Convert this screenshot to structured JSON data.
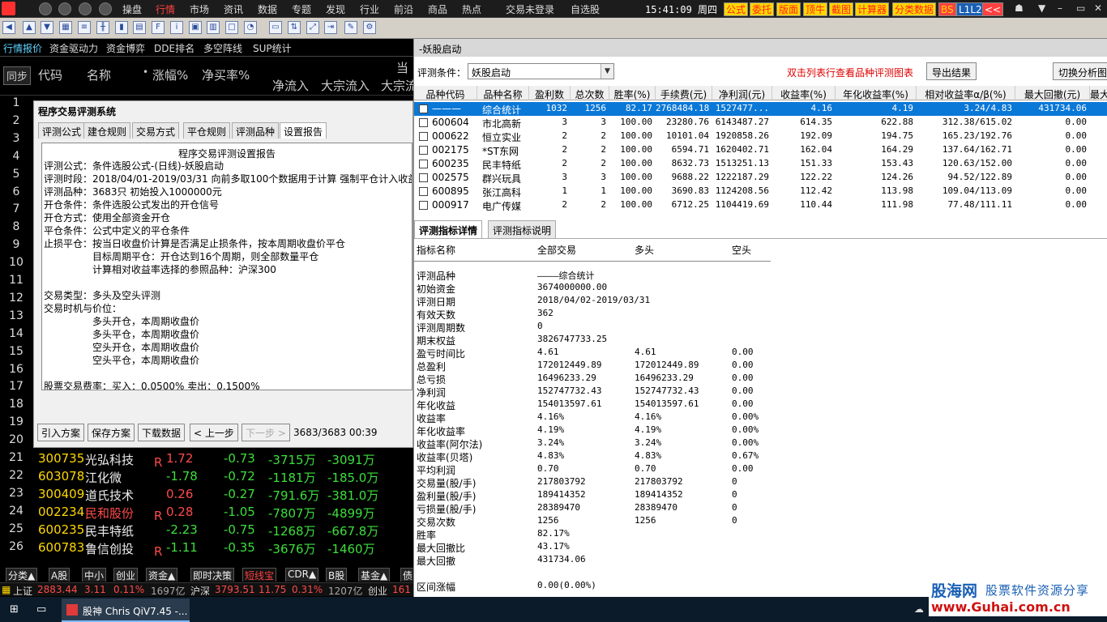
{
  "menubar": {
    "items": [
      "操盘",
      "行情",
      "市场",
      "资讯",
      "数据",
      "专题",
      "发现",
      "行业",
      "前沿",
      "商品",
      "热点"
    ],
    "active_index": 1,
    "login": "交易未登录",
    "watchlist": "自选股",
    "clock": "15:41:09 周四",
    "right_buttons": [
      "公式",
      "委托",
      "版面",
      "顶牛",
      "截图",
      "计算器",
      "分类数据",
      "BS",
      "L1L2",
      "<<"
    ]
  },
  "left_tabs": [
    "行情报价",
    "资金驱动力",
    "资金博弈",
    "DDE排名",
    "多空阵线",
    "SUP统计"
  ],
  "quote_header": {
    "sync": "同步",
    "code": "代码",
    "name": "名称",
    "dot": "•",
    "change_pct": "涨幅%",
    "net_buy_rate": "净买率%",
    "current": "当",
    "net_inflow": "净流入",
    "big_inflow": "大宗流入",
    "big_out": "大宗流"
  },
  "row_numbers": [
    "1",
    "2",
    "3",
    "4",
    "5",
    "6",
    "7",
    "8",
    "9",
    "10",
    "11",
    "12",
    "13",
    "14",
    "15",
    "16",
    "17",
    "18",
    "19",
    "20"
  ],
  "quote_rows": [
    {
      "num": "21",
      "code": "300735",
      "name": "光弘科技",
      "badge": "R",
      "chg": "1.72",
      "chg_color": "r",
      "rate": "-0.73",
      "inflow": "-3715万",
      "big": "-3091万",
      "name_color": ""
    },
    {
      "num": "22",
      "code": "603078",
      "name": "江化微",
      "badge": "",
      "chg": "-1.78",
      "chg_color": "g",
      "rate": "-0.72",
      "inflow": "-1181万",
      "big": "-185.0万",
      "name_color": ""
    },
    {
      "num": "23",
      "code": "300409",
      "name": "道氏技术",
      "badge": "",
      "chg": "0.26",
      "chg_color": "r",
      "rate": "-0.27",
      "inflow": "-791.6万",
      "big": "-381.0万",
      "name_color": ""
    },
    {
      "num": "24",
      "code": "002234",
      "name": "民和股份",
      "badge": "R",
      "chg": "0.28",
      "chg_color": "r",
      "rate": "-1.05",
      "inflow": "-7807万",
      "big": "-4899万",
      "name_color": "red"
    },
    {
      "num": "25",
      "code": "600235",
      "name": "民丰特纸",
      "badge": "",
      "chg": "-2.23",
      "chg_color": "g",
      "rate": "-0.75",
      "inflow": "-1268万",
      "big": "-667.8万",
      "name_color": ""
    },
    {
      "num": "26",
      "code": "600783",
      "name": "鲁信创投",
      "badge": "R",
      "chg": "-1.11",
      "chg_color": "g",
      "rate": "-0.35",
      "inflow": "-3676万",
      "big": "-1460万",
      "name_color": ""
    }
  ],
  "bottom_tabs": [
    "分类▲",
    "A股",
    "中小",
    "创业",
    "资金▲",
    "即时决策",
    "短线宝",
    "CDR▲",
    "B股",
    "基金▲",
    "债"
  ],
  "bottom_active": 6,
  "status": {
    "sh_label": "上证",
    "sh_value": "2883.44",
    "sh_chg": "3.11",
    "sh_pct": "0.11%",
    "sh_vol": "1697亿",
    "sz_label": "沪深",
    "sz_value": "3793.51",
    "sz_chg": "11.75",
    "sz_pct": "0.31%",
    "sz_vol": "1207亿",
    "cy_label": "创业",
    "cy_value": "161"
  },
  "taskbar": {
    "app": "股神 Chris QiV7.45 -..."
  },
  "dialog": {
    "title": "程序交易评测系统",
    "tabs": [
      "评测公式",
      "建仓规则",
      "交易方式",
      "平仓规则",
      "评测品种",
      "设置报告"
    ],
    "active_tab": 5,
    "report_title": "程序交易评测设置报告",
    "lines": [
      "评测公式：条件选股公式-(日线)-妖股启动",
      "评测时段：2018/04/01-2019/03/31 向前多取100个数据用于计算 强制平仓计入收益",
      "评测品种：3683只 初始投入1000000元",
      "开仓条件：条件选股公式发出的开仓信号",
      "开仓方式：使用全部资金开仓",
      "平仓条件：公式中定义的平仓条件",
      "止损平仓：按当日收盘价计算是否满足止损条件，按本周期收盘价平仓",
      "目标周期平仓：开仓达到16个周期，则全部数量平仓",
      "计算相对收益率选择的参照品种：沪深300",
      "",
      "交易类型：多头及空头评测",
      "交易时机与价位：",
      "多头开仓，本周期收盘价",
      "多头平仓，本周期收盘价",
      "空头开仓，本周期收盘价",
      "空头平仓，本周期收盘价",
      "",
      "股票交易费率：买入：0.0500% 卖出：0.1500%"
    ],
    "buttons": [
      "引入方案",
      "保存方案",
      "下载数据",
      "< 上一步",
      "下一步 >"
    ],
    "progress": "3683/3683 00:39"
  },
  "rpanel": {
    "title": "-妖股启动",
    "cond_label": "评测条件：",
    "cond_value": "妖股启动",
    "hint": "双击列表行查看品种评测图表",
    "export": "导出结果",
    "switch": "切换分析图",
    "grid_headers": [
      "品种代码",
      "品种名称",
      "盈利数",
      "总次数",
      "胜率(%)",
      "手续费(元)",
      "净利润(元)",
      "收益率(%)",
      "年化收益率(%)",
      "相对收益率α/β(%)",
      "最大回撤(元)",
      "最大"
    ],
    "grid_rows": [
      [
        "———",
        "综合统计",
        "1032",
        "1256",
        "82.17",
        "2768484.18",
        "1527477...",
        "4.16",
        "4.19",
        "3.24/4.83",
        "431734.06"
      ],
      [
        "600604",
        "市北高新",
        "3",
        "3",
        "100.00",
        "23280.76",
        "6143487.27",
        "614.35",
        "622.88",
        "312.38/615.02",
        "0.00"
      ],
      [
        "000622",
        "恒立实业",
        "2",
        "2",
        "100.00",
        "10101.04",
        "1920858.26",
        "192.09",
        "194.75",
        "165.23/192.76",
        "0.00"
      ],
      [
        "002175",
        "*ST东网",
        "2",
        "2",
        "100.00",
        "6594.71",
        "1620402.71",
        "162.04",
        "164.29",
        "137.64/162.71",
        "0.00"
      ],
      [
        "600235",
        "民丰特纸",
        "2",
        "2",
        "100.00",
        "8632.73",
        "1513251.13",
        "151.33",
        "153.43",
        "120.63/152.00",
        "0.00"
      ],
      [
        "002575",
        "群兴玩具",
        "3",
        "3",
        "100.00",
        "9688.22",
        "1222187.29",
        "122.22",
        "124.26",
        "94.52/122.89",
        "0.00"
      ],
      [
        "600895",
        "张江高科",
        "1",
        "1",
        "100.00",
        "3690.83",
        "1124208.56",
        "112.42",
        "113.98",
        "109.04/113.09",
        "0.00"
      ],
      [
        "000917",
        "电广传媒",
        "2",
        "2",
        "100.00",
        "6712.25",
        "1104419.69",
        "110.44",
        "111.98",
        "77.48/111.11",
        "0.00"
      ]
    ],
    "sub_tabs": [
      "评测指标详情",
      "评测指标说明"
    ],
    "stats_headers": [
      "指标名称",
      "全部交易",
      "多头",
      "空头"
    ],
    "stats": [
      [
        "评测品种",
        "————综合统计",
        "",
        ""
      ],
      [
        "初始资金",
        "3674000000.00",
        "",
        ""
      ],
      [
        "评测日期",
        "2018/04/02-2019/03/31",
        "",
        ""
      ],
      [
        "有效天数",
        "362",
        "",
        ""
      ],
      [
        "评测周期数",
        "0",
        "",
        ""
      ],
      [
        "期末权益",
        "3826747733.25",
        "",
        ""
      ],
      [
        "盈亏时间比",
        "4.61",
        "4.61",
        "0.00"
      ],
      [
        "总盈利",
        "172012449.89",
        "172012449.89",
        "0.00"
      ],
      [
        "总亏损",
        "16496233.29",
        "16496233.29",
        "0.00"
      ],
      [
        "净利润",
        "152747732.43",
        "152747732.43",
        "0.00"
      ],
      [
        "年化收益",
        "154013597.61",
        "154013597.61",
        "0.00"
      ],
      [
        "收益率",
        "4.16%",
        "4.16%",
        "0.00%"
      ],
      [
        "年化收益率",
        "4.19%",
        "4.19%",
        "0.00%"
      ],
      [
        "收益率(阿尔法)",
        "3.24%",
        "3.24%",
        "0.00%"
      ],
      [
        "收益率(贝塔)",
        "4.83%",
        "4.83%",
        "0.67%"
      ],
      [
        "平均利润",
        "0.70",
        "0.70",
        "0.00"
      ],
      [
        "交易量(股/手)",
        "217803792",
        "217803792",
        "0"
      ],
      [
        "盈利量(股/手)",
        "189414352",
        "189414352",
        "0"
      ],
      [
        "亏损量(股/手)",
        "28389470",
        "28389470",
        "0"
      ],
      [
        "交易次数",
        "1256",
        "1256",
        "0"
      ],
      [
        "胜率",
        "82.17%",
        "",
        ""
      ],
      [
        "最大回撤比",
        "43.17%",
        "",
        ""
      ],
      [
        "最大回撤",
        "431734.06",
        "",
        ""
      ],
      [
        "",
        "",
        " ",
        ""
      ],
      [
        "区间涨幅",
        "0.00(0.00%)",
        "",
        ""
      ]
    ]
  },
  "watermark": {
    "brand": "股海网",
    "slogan": "股票软件资源分享",
    "url": "www.Guhai.com.cn"
  },
  "colors": {
    "up": "#ff4a4a",
    "down": "#3dde3d",
    "code": "#ffd700",
    "select": "#0a78d7"
  }
}
